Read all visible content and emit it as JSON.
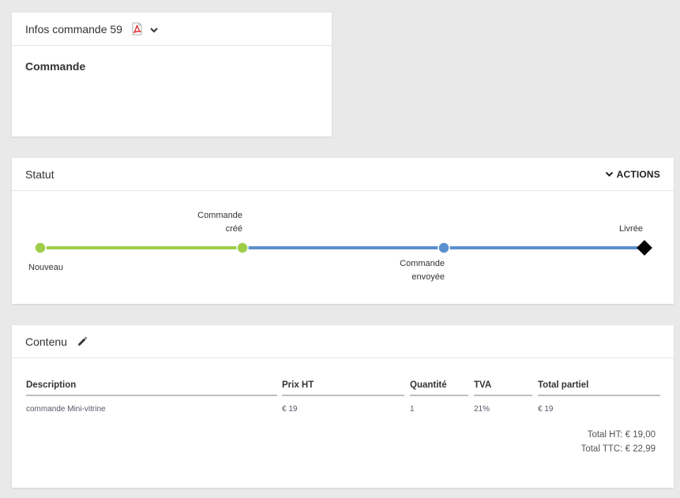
{
  "infos": {
    "title": "Infos commande 59",
    "section_title": "Commande"
  },
  "statut": {
    "title": "Statut",
    "actions_label": "ACTIONS",
    "steps": [
      {
        "label_line1": "Nouveau",
        "label_line2": ""
      },
      {
        "label_line1": "Commande",
        "label_line2": "créé"
      },
      {
        "label_line1": "Commande",
        "label_line2": "envoyée"
      },
      {
        "label_line1": "Livrée",
        "label_line2": ""
      }
    ],
    "colors": {
      "done": "#9ecd4a",
      "pending": "#5b8fce",
      "final": "#000000"
    }
  },
  "contenu": {
    "title": "Contenu",
    "columns": [
      "Description",
      "Prix HT",
      "Quantité",
      "TVA",
      "Total partiel"
    ],
    "rows": [
      [
        "commande Mini-vitrine",
        "€ 19",
        "1",
        "21%",
        "€ 19"
      ]
    ],
    "total_ht": "Total HT: € 19,00",
    "total_ttc": "Total TTC: € 22,99"
  }
}
